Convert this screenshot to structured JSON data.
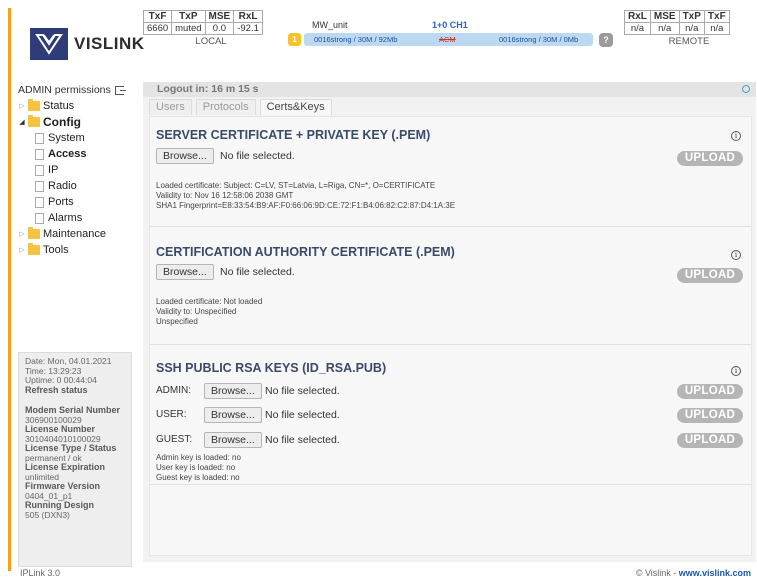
{
  "brand": {
    "logo_text": "VISLINK",
    "logo_icon": "vislink-v-icon",
    "accent_color": "#f3a21b",
    "logo_color": "#2f3c78"
  },
  "local": {
    "headers": [
      "TxF",
      "TxP",
      "MSE",
      "RxL"
    ],
    "values": [
      "6660",
      "muted",
      "0.0",
      "-92.1"
    ],
    "label": "LOCAL"
  },
  "remote": {
    "headers": [
      "RxL",
      "MSE",
      "TxP",
      "TxF"
    ],
    "values": [
      "n/a",
      "n/a",
      "n/a",
      "n/a"
    ],
    "label": "REMOTE"
  },
  "link": {
    "unit_label": "MW_unit",
    "channel": "1+0 CH1",
    "badge": "1",
    "left_text": "0016strong / 30M / 92Mb",
    "mid_text": "ACM",
    "right_text": "0016strong / 30M / 0Mb",
    "help": "?"
  },
  "sidebar": {
    "admin_label": "ADMIN permissions",
    "tree": [
      {
        "label": "Status",
        "level": 0,
        "type": "folder",
        "expanded": false
      },
      {
        "label": "Config",
        "level": 0,
        "type": "folder",
        "expanded": true
      },
      {
        "label": "System",
        "level": 1,
        "type": "page"
      },
      {
        "label": "Access",
        "level": 1,
        "type": "page",
        "active": true
      },
      {
        "label": "IP",
        "level": 1,
        "type": "page"
      },
      {
        "label": "Radio",
        "level": 1,
        "type": "page"
      },
      {
        "label": "Ports",
        "level": 1,
        "type": "page"
      },
      {
        "label": "Alarms",
        "level": 1,
        "type": "page"
      },
      {
        "label": "Maintenance",
        "level": 0,
        "type": "folder",
        "expanded": false
      },
      {
        "label": "Tools",
        "level": 0,
        "type": "folder",
        "expanded": false
      }
    ],
    "info": {
      "date": "Date: Mon, 04.01.2021",
      "time": "Time: 13:29:23",
      "uptime": "Uptime: 0 00:44:04",
      "refresh": "Refresh status",
      "serial_label": "Modem Serial Number",
      "serial_value": "306900100029",
      "license_label": "License Number",
      "license_value": "3010404010100029",
      "ltype_label": "License Type / Status",
      "ltype_value": "permanent / ok",
      "lexp_label": "License Expiration",
      "lexp_value": "unlimited",
      "fw_label": "Firmware Version",
      "fw_value": "0404_01_p1",
      "rd_label": "Running Design",
      "rd_value": "505 (DXN3)"
    }
  },
  "main": {
    "logout_text": "Logout in: 16 m 15 s",
    "tabs": [
      "Users",
      "Protocols",
      "Certs&Keys"
    ],
    "active_tab": "Certs&Keys",
    "server_cert": {
      "title": "SERVER CERTIFICATE + PRIVATE KEY (.PEM)",
      "browse": "Browse...",
      "no_file": "No file selected.",
      "upload": "UPLOAD",
      "line1": "Loaded certificate: Subject: C=LV, ST=Latvia, L=Riga, CN=*, O=CERTIFICATE",
      "line2": "Validity to: Nov 16 12:58:06 2038 GMT",
      "line3": "SHA1 Fingerprint=E8:33:54:B9:AF:F0:66:06:9D:CE:72:F1:B4:06:82:C2:87:D4:1A:3E"
    },
    "ca_cert": {
      "title": "CERTIFICATION AUTHORITY CERTIFICATE (.PEM)",
      "browse": "Browse...",
      "no_file": "No file selected.",
      "upload": "UPLOAD",
      "line1": "Loaded certificate: Not loaded",
      "line2": "Validity to: Unspecified",
      "line3": "Unspecified"
    },
    "ssh": {
      "title": "SSH PUBLIC RSA KEYS (ID_RSA.PUB)",
      "rows": [
        {
          "label": "ADMIN:",
          "browse": "Browse...",
          "no_file": "No file selected.",
          "upload": "UPLOAD"
        },
        {
          "label": "USER:",
          "browse": "Browse...",
          "no_file": "No file selected.",
          "upload": "UPLOAD"
        },
        {
          "label": "GUEST:",
          "browse": "Browse...",
          "no_file": "No file selected.",
          "upload": "UPLOAD"
        }
      ],
      "line1": "Admin key is loaded: no",
      "line2": "User key is loaded: no",
      "line3": "Guest key is loaded: no"
    }
  },
  "footer": {
    "version": "IPLink 3.0",
    "copyright": "© Vislink - ",
    "site": "www.vislink.com"
  }
}
